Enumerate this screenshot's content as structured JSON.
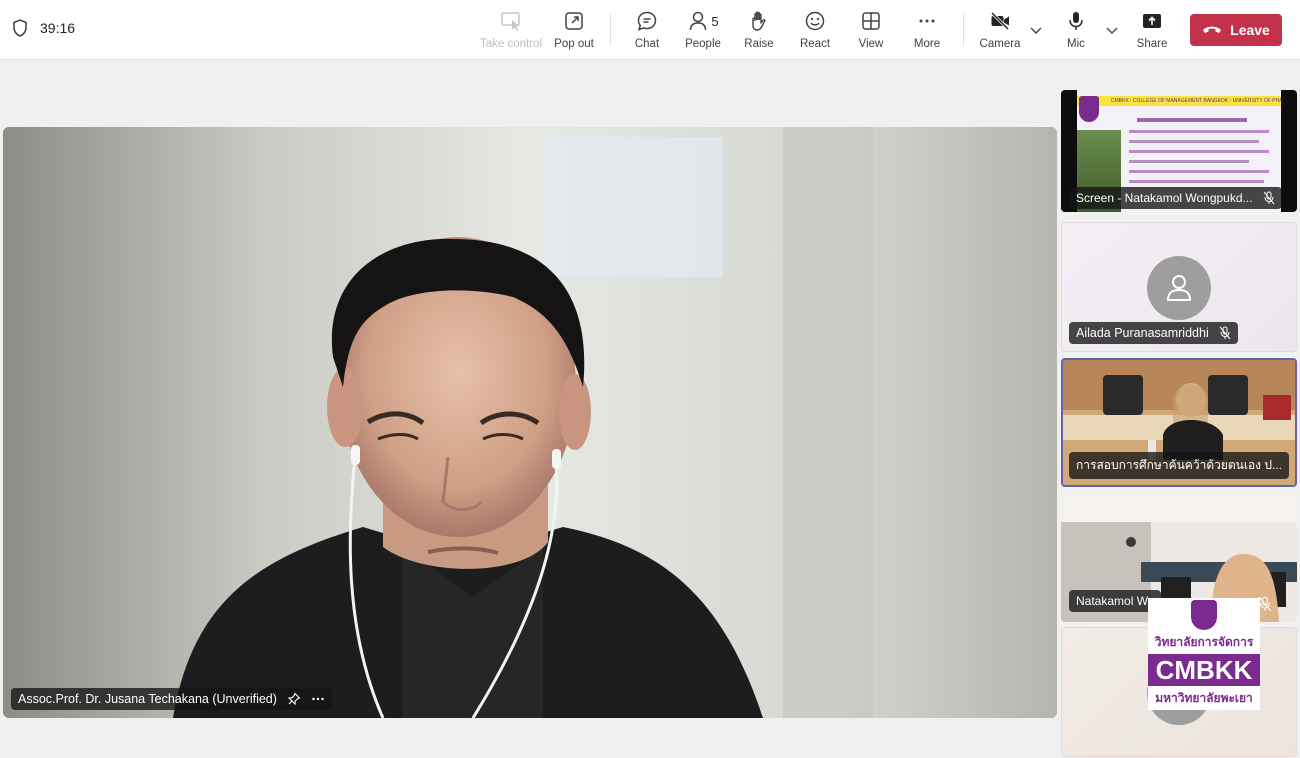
{
  "meeting": {
    "elapsed_time": "39:16"
  },
  "toolbar": {
    "take_control": "Take control",
    "pop_out": "Pop out",
    "chat": "Chat",
    "people": "People",
    "people_count": "5",
    "raise": "Raise",
    "react": "React",
    "view": "View",
    "more": "More",
    "camera": "Camera",
    "mic": "Mic",
    "share": "Share",
    "leave": "Leave"
  },
  "main_stage": {
    "name": "Assoc.Prof. Dr. Jusana Techakana (Unverified)"
  },
  "tiles": [
    {
      "name": "Screen - Natakamol Wongpukd...",
      "slide_header": "CMBKK : COLLEGE OF MANAGEMENT BANGKOK - UNIVERSITY OF PHAYAO"
    },
    {
      "name": "Ailada Puranasamriddhi"
    },
    {
      "name": "การสอบการศึกษาค้นคว้าด้วยตนเอง ป..."
    },
    {
      "name": "Natakamol Wo"
    }
  ],
  "watermark": {
    "line1": "วิทยาลัยการจัดการ",
    "line2": "CMBKK",
    "line3": "มหาวิทยาลัยพะเยา"
  },
  "colors": {
    "leave": "#c4314b",
    "brand_purple": "#7b2a8e",
    "active_tile_border": "#6264a7"
  }
}
